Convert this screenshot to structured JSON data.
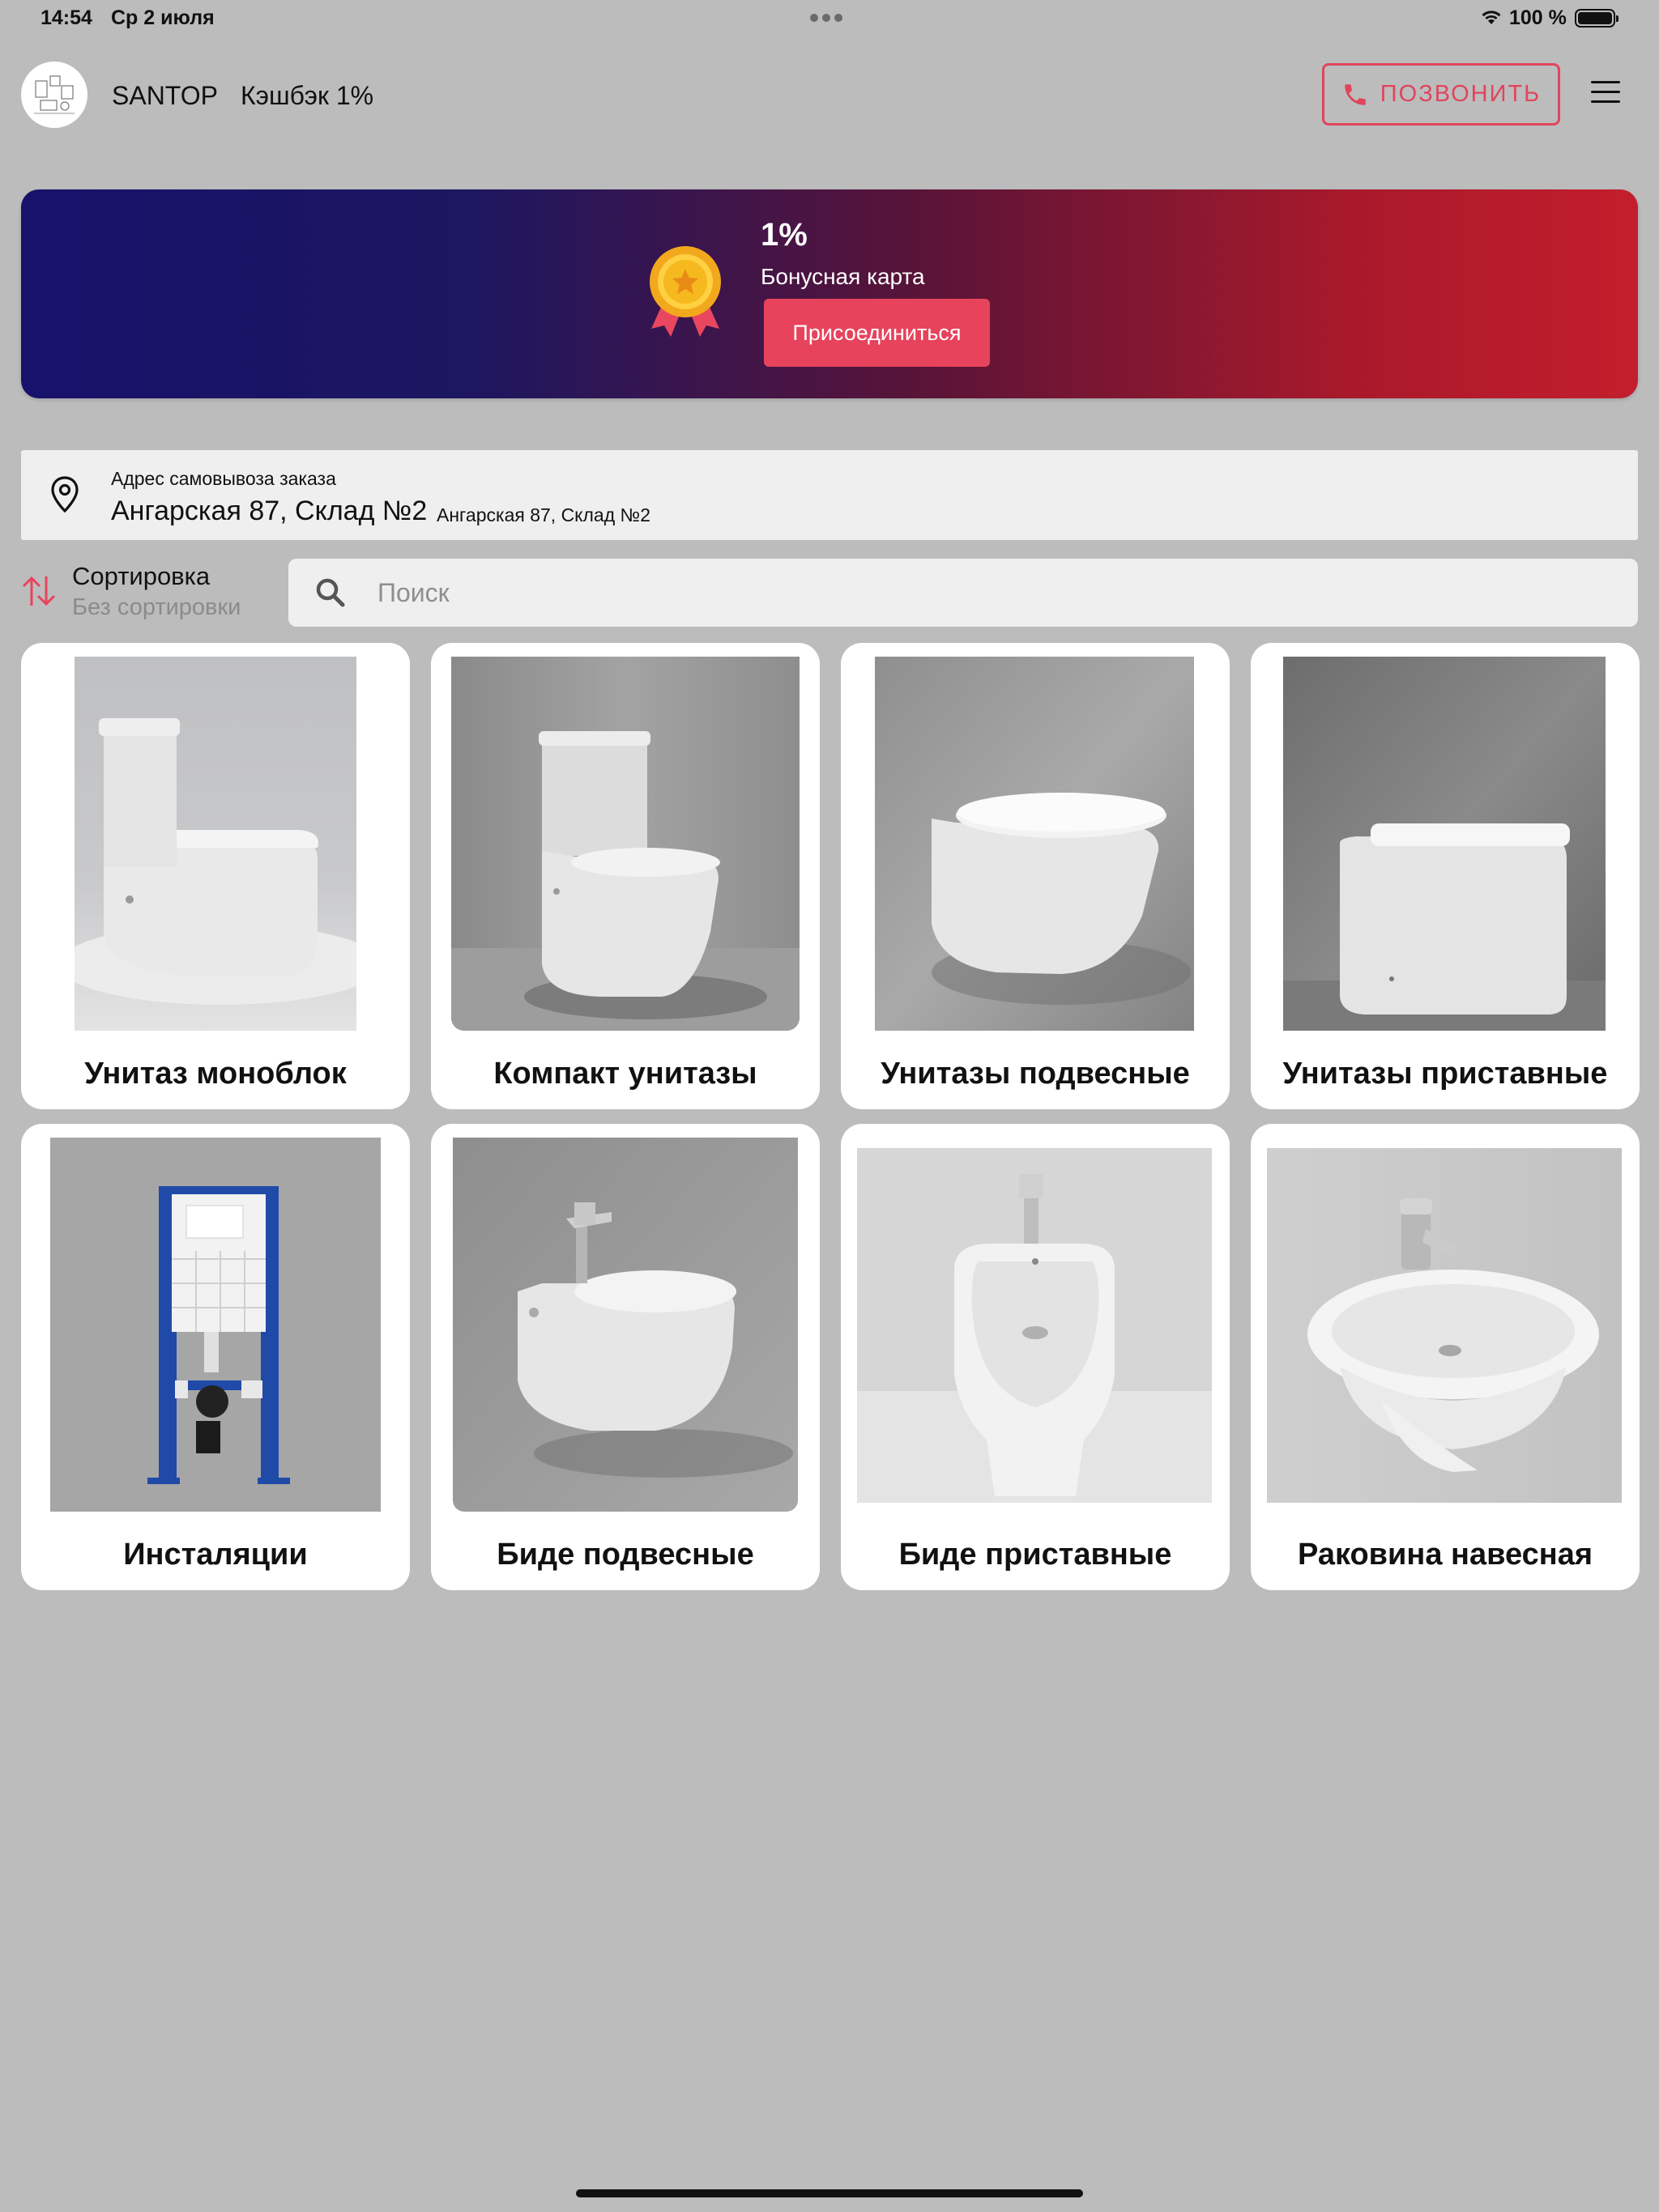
{
  "status_bar": {
    "time": "14:54",
    "date": "Ср 2 июля",
    "battery": "100 %"
  },
  "header": {
    "brand": "SANTOP",
    "cashback": "Кэшбэк 1%",
    "call_label": "ПОЗВОНИТЬ"
  },
  "banner": {
    "percent": "1%",
    "title": "Бонусная карта",
    "join_label": "Присоединиться"
  },
  "pickup": {
    "label": "Адрес самовывоза заказа",
    "address": "Ангарская 87, Склад №2",
    "address_detail": "Ангарская 87, Склад №2"
  },
  "sort": {
    "title": "Сортировка",
    "value": "Без сортировки"
  },
  "search": {
    "placeholder": "Поиск"
  },
  "categories": [
    {
      "label": "Унитаз моноблок",
      "icon": "monoblock-toilet-image"
    },
    {
      "label": "Компакт унитазы",
      "icon": "compact-toilet-image"
    },
    {
      "label": "Унитазы подвесные",
      "icon": "wall-hung-toilet-image"
    },
    {
      "label": "Унитазы приставные",
      "icon": "back-to-wall-toilet-image"
    },
    {
      "label": "Инсталяции",
      "icon": "installation-frame-image"
    },
    {
      "label": "Биде подвесные",
      "icon": "wall-hung-bidet-image"
    },
    {
      "label": "Биде приставные",
      "icon": "floor-bidet-image"
    },
    {
      "label": "Раковина навесная",
      "icon": "wall-sink-image"
    }
  ],
  "colors": {
    "accent": "#e7435c",
    "banner_start": "#17126b",
    "banner_end": "#c41e2c",
    "background": "#bcbcbd"
  }
}
